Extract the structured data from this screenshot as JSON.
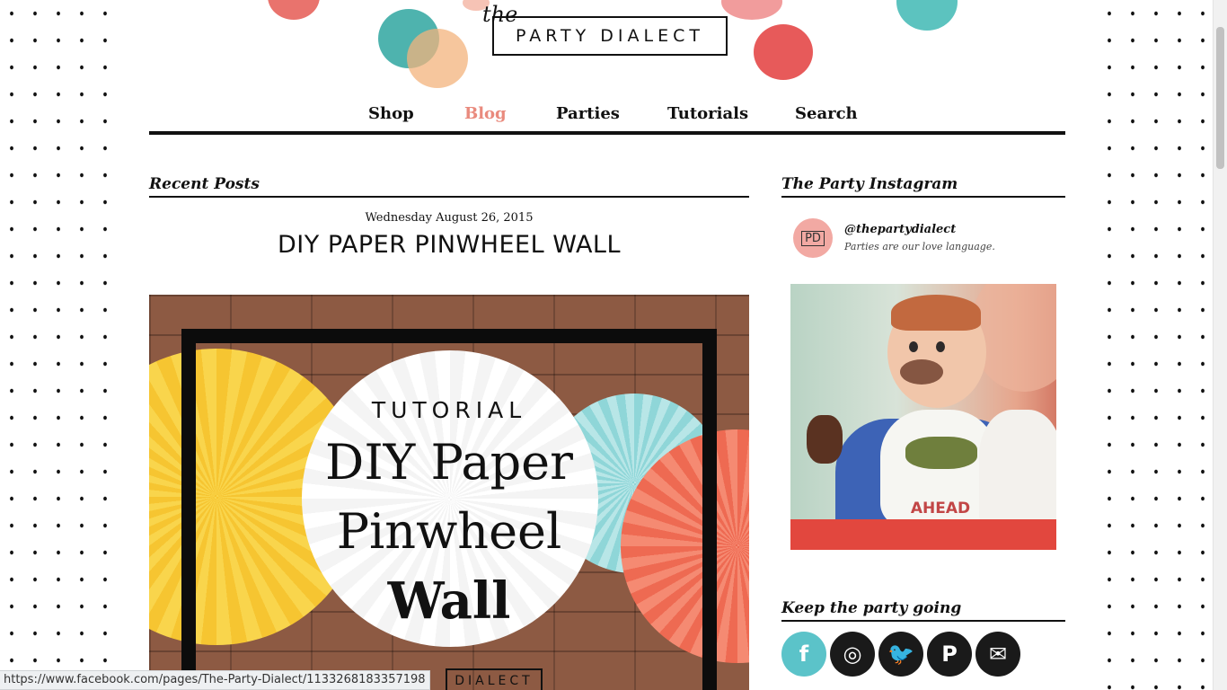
{
  "site": {
    "logo_the": "the",
    "logo_name": "PARTY DIALECT"
  },
  "nav": {
    "items": [
      "Shop",
      "Blog",
      "Parties",
      "Tutorials",
      "Search"
    ],
    "active": "Blog"
  },
  "main": {
    "section_title": "Recent Posts",
    "post": {
      "date": "Wednesday August 26, 2015",
      "title": "DIY PAPER PINWHEEL WALL",
      "image_text": {
        "kicker": "TUTORIAL",
        "line1": "DIY Paper",
        "line2": "Pinwheel",
        "line3": "Wall",
        "footer": "DIALECT"
      }
    }
  },
  "sidebar": {
    "instagram_title": "The Party Instagram",
    "avatar_text": "PD",
    "handle": "@thepartydialect",
    "bio": "Parties are our love language.",
    "bib_text": "AHEAD",
    "social_title": "Keep the party going",
    "social_icons": [
      {
        "name": "facebook-icon",
        "glyph": "f",
        "color": "#5bc3c9"
      },
      {
        "name": "instagram-icon",
        "glyph": "◎",
        "color": "#1a1a1a"
      },
      {
        "name": "twitter-icon",
        "glyph": "🐦",
        "color": "#1a1a1a"
      },
      {
        "name": "pinterest-icon",
        "glyph": "P",
        "color": "#1a1a1a"
      },
      {
        "name": "email-icon",
        "glyph": "✉",
        "color": "#1a1a1a"
      }
    ]
  },
  "status_bar": {
    "url": "https://www.facebook.com/pages/The-Party-Dialect/1133268183357198"
  }
}
